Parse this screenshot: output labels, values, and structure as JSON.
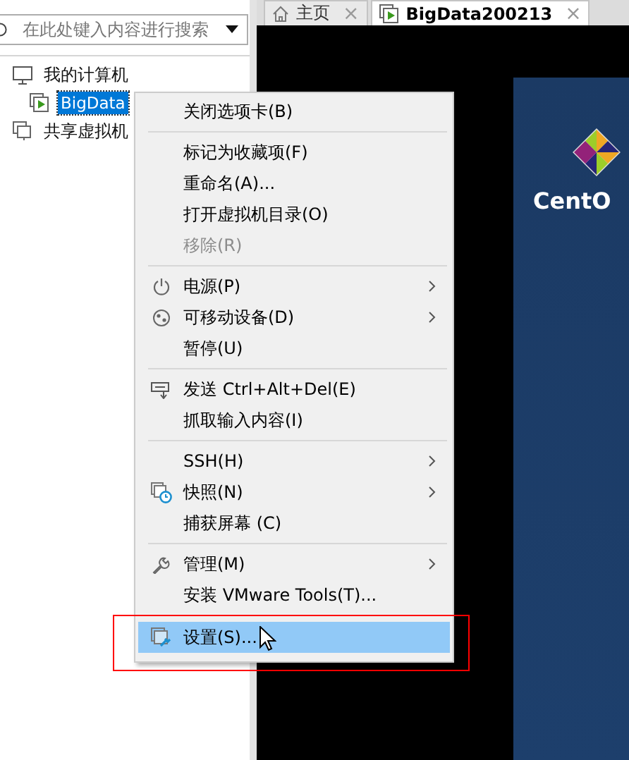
{
  "library": {
    "search": {
      "placeholder": "在此处键入内容进行搜索"
    },
    "tree": [
      {
        "label": "我的计算机",
        "kind": "computer",
        "selected": false,
        "children": [
          {
            "label": "BigData",
            "kind": "vm",
            "selected": true
          }
        ]
      },
      {
        "label": "共享虚拟机",
        "kind": "shared",
        "selected": false
      }
    ]
  },
  "tabs": [
    {
      "label": "主页",
      "kind": "home",
      "selected": false,
      "close": "×"
    },
    {
      "label": "BigData200213",
      "kind": "vm",
      "selected": true,
      "close": "×"
    }
  ],
  "vm_screen": {
    "brand": "CentO"
  },
  "context_menu": {
    "items": [
      {
        "kind": "item",
        "label": "关闭选项卡(B)",
        "disabled": false,
        "submenu": false,
        "selected": false
      },
      {
        "kind": "separator"
      },
      {
        "kind": "item",
        "label": "标记为收藏项(F)",
        "disabled": false,
        "submenu": false,
        "selected": false
      },
      {
        "kind": "item",
        "label": "重命名(A)...",
        "disabled": false,
        "submenu": false,
        "selected": false
      },
      {
        "kind": "item",
        "label": "打开虚拟机目录(O)",
        "disabled": false,
        "submenu": false,
        "selected": false
      },
      {
        "kind": "item",
        "label": "移除(R)",
        "disabled": true,
        "submenu": false,
        "selected": false
      },
      {
        "kind": "separator"
      },
      {
        "kind": "item",
        "label": "电源(P)",
        "disabled": false,
        "submenu": true,
        "selected": false
      },
      {
        "kind": "item",
        "label": "可移动设备(D)",
        "disabled": false,
        "submenu": true,
        "selected": false
      },
      {
        "kind": "item",
        "label": "暂停(U)",
        "disabled": false,
        "submenu": false,
        "selected": false
      },
      {
        "kind": "separator"
      },
      {
        "kind": "item",
        "label": "发送 Ctrl+Alt+Del(E)",
        "disabled": false,
        "submenu": false,
        "selected": false
      },
      {
        "kind": "item",
        "label": "抓取输入内容(I)",
        "disabled": false,
        "submenu": false,
        "selected": false
      },
      {
        "kind": "separator"
      },
      {
        "kind": "item",
        "label": "SSH(H)",
        "disabled": false,
        "submenu": true,
        "selected": false
      },
      {
        "kind": "item",
        "label": "快照(N)",
        "disabled": false,
        "submenu": true,
        "selected": false
      },
      {
        "kind": "item",
        "label": "捕获屏幕 (C)",
        "disabled": false,
        "submenu": false,
        "selected": false
      },
      {
        "kind": "separator"
      },
      {
        "kind": "item",
        "label": "管理(M)",
        "disabled": false,
        "submenu": true,
        "selected": false
      },
      {
        "kind": "item",
        "label": "安装 VMware Tools(T)...",
        "disabled": false,
        "submenu": false,
        "selected": false
      },
      {
        "kind": "gap"
      },
      {
        "kind": "item",
        "label": "设置(S)...",
        "disabled": false,
        "submenu": false,
        "selected": true
      }
    ]
  }
}
